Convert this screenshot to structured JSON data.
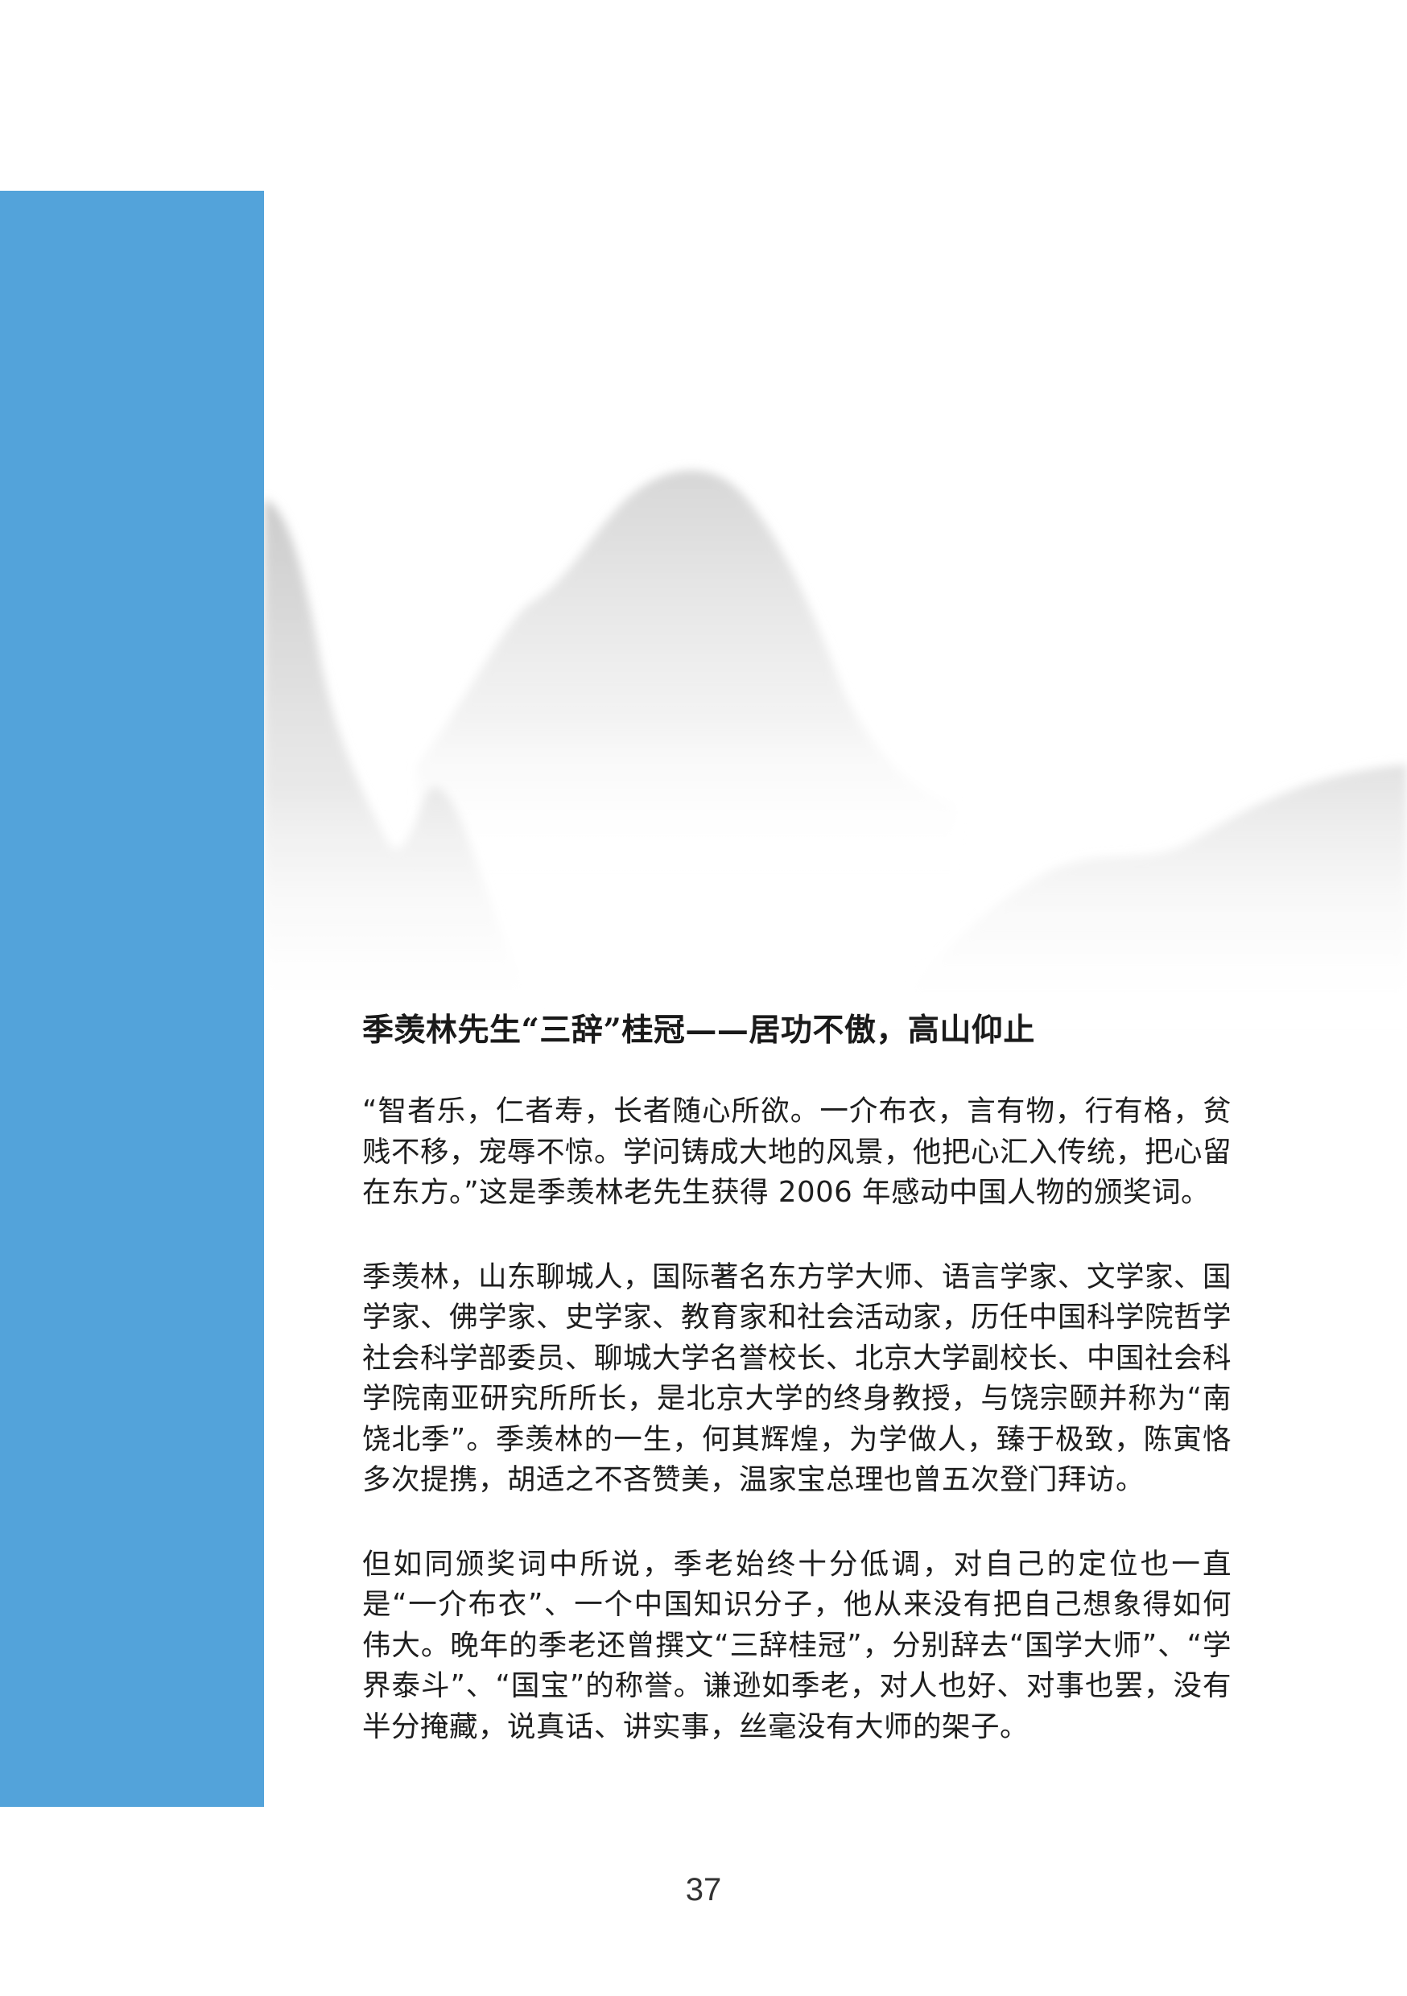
{
  "article": {
    "title": "季羡林先生“三辞”桂冠——居功不傲，高山仰止",
    "paragraphs": [
      "“智者乐，仁者寿，长者随心所欲。一介布衣，言有物，行有格，贫贱不移，宠辱不惊。学问铸成大地的风景，他把心汇入传统，把心留在东方。”这是季羡林老先生获得 2006 年感动中国人物的颁奖词。",
      "季羡林，山东聊城人，国际著名东方学大师、语言学家、文学家、国学家、佛学家、史学家、教育家和社会活动家，历任中国科学院哲学社会科学部委员、聊城大学名誉校长、北京大学副校长、中国社会科学院南亚研究所所长，是北京大学的终身教授，与饶宗颐并称为“南饶北季”。季羡林的一生，何其辉煌，为学做人，臻于极致，陈寅恪多次提携，胡适之不吝赞美，温家宝总理也曾五次登门拜访。",
      "但如同颁奖词中所说，季老始终十分低调，对自己的定位也一直是“一介布衣”、一个中国知识分子，他从来没有把自己想象得如何伟大。晚年的季老还曾撰文“三辞桂冠”，分别辞去“国学大师”、“学界泰斗”、“国宝”的称誉。谦逊如季老，对人也好、对事也罢，没有半分掩藏，说真话、讲实事，丝毫没有大师的架子。"
    ]
  },
  "page_number": "37",
  "colors": {
    "accent_bar": "#53a3da",
    "text": "#1e1e1e",
    "mountain_gray": "#c8c8c8"
  }
}
